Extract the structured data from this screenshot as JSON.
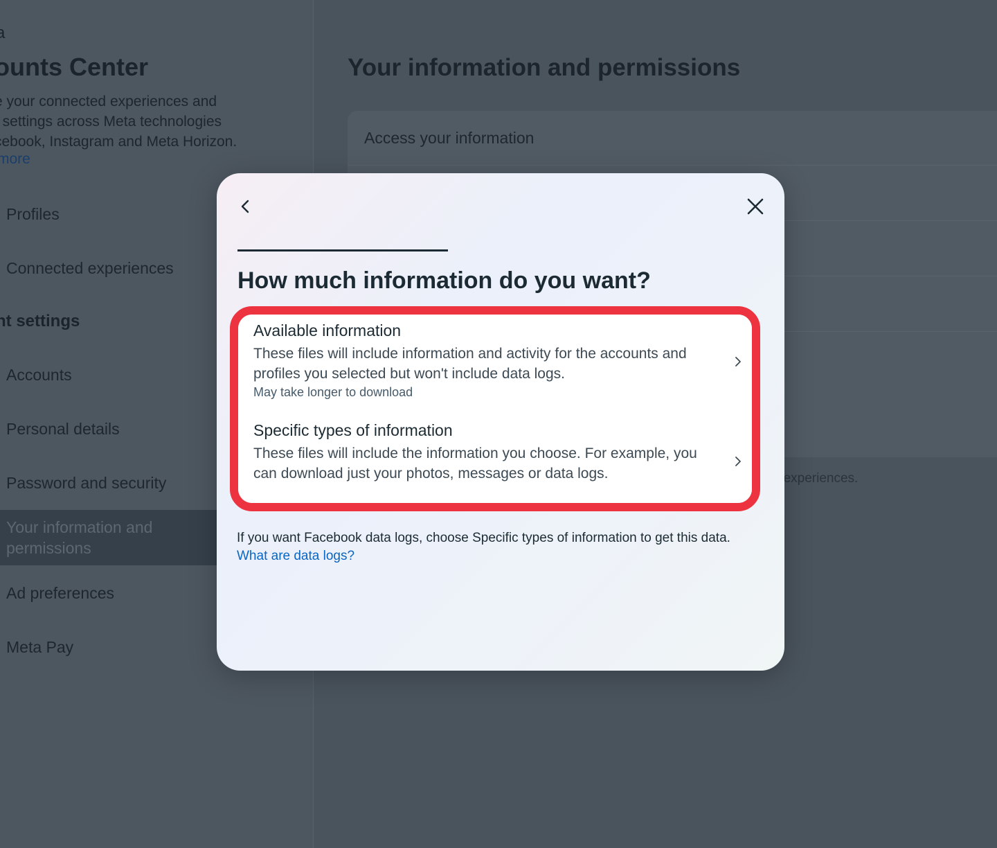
{
  "sidebar": {
    "brand": "a",
    "title": "ounts Center",
    "description": "e your connected experiences and\nt settings across Meta technologies\ncebook, Instagram and Meta Horizon.",
    "more_link": "more",
    "items": [
      {
        "label": "Profiles"
      },
      {
        "label": "Connected experiences"
      },
      {
        "label": "nt settings"
      },
      {
        "label": "Accounts"
      },
      {
        "label": "Personal details"
      },
      {
        "label": "Password and security"
      },
      {
        "label": "Your information and permissions"
      },
      {
        "label": "Ad preferences"
      },
      {
        "label": "Meta Pay"
      }
    ]
  },
  "main": {
    "title": "Your information and permissions",
    "first_row": "Access your information",
    "footer_fragment": "r experiences."
  },
  "modal": {
    "title": "How much information do you want?",
    "options": [
      {
        "title": "Available information",
        "description": "These files will include information and activity for the accounts and profiles you selected but won't include data logs.",
        "meta": "May take longer to download"
      },
      {
        "title": "Specific types of information",
        "description": "These files will include the information you choose. For example, you can download just your photos, messages or data logs."
      }
    ],
    "note_text": "If you want Facebook data logs, choose Specific types of information to get this data. ",
    "note_link": "What are data logs?"
  },
  "colors": {
    "highlight": "#ee3340",
    "link": "#0a66c2",
    "overlay": "#4a545d"
  },
  "icons": {
    "back": "chevron-left-icon",
    "close": "close-icon",
    "option_chevron": "chevron-right-icon"
  }
}
